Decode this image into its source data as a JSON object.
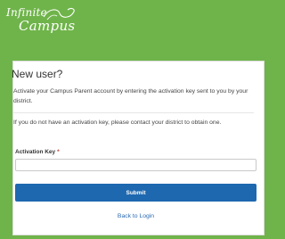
{
  "brand": {
    "line1": "Infinite",
    "line2": "Campus",
    "logo_color": "#ffffff",
    "background": "#6fb44a"
  },
  "card": {
    "title": "New user?",
    "intro": "Activate your Campus Parent account by entering the activation key sent to you by your district.",
    "no_key_text": "If you do not have an activation key, please contact your district to obtain one.",
    "field_label": "Activation Key",
    "required_marker": "*",
    "field_value": "",
    "field_placeholder": "",
    "submit_label": "Submit",
    "back_link": "Back to Login",
    "accent_color": "#1e68b0"
  }
}
